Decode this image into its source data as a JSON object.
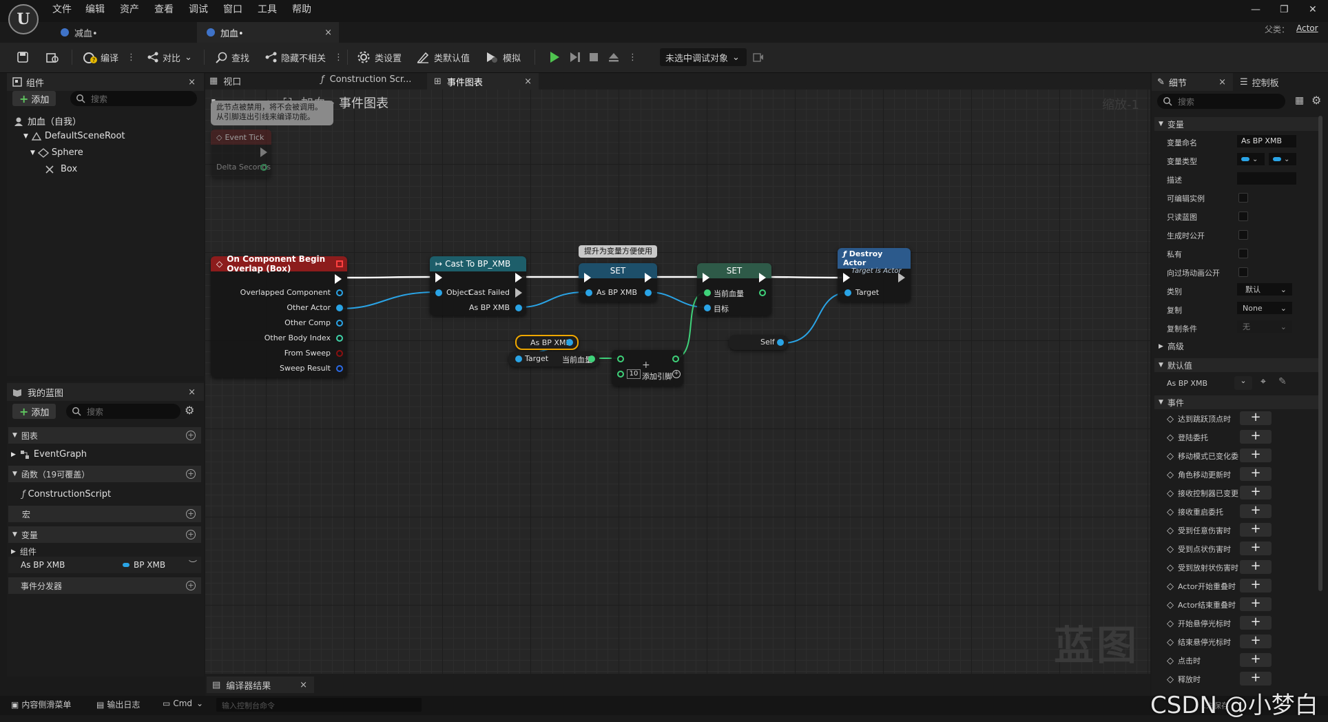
{
  "menu": [
    "文件",
    "编辑",
    "资产",
    "查看",
    "调试",
    "窗口",
    "工具",
    "帮助"
  ],
  "logo_text": "U",
  "window_controls": {
    "minimize": "—",
    "restore": "❐",
    "close": "✕"
  },
  "parent_class": {
    "label": "父类：",
    "value": "Actor"
  },
  "doc_tabs": [
    {
      "label": "减血•"
    },
    {
      "label": "加血•"
    }
  ],
  "tab_close": "×",
  "toolbar": {
    "compile": "编译",
    "diff": "对比",
    "find": "查找",
    "hide_unrelated": "隐藏不相关",
    "class_settings": "类设置",
    "class_defaults": "类默认值",
    "simulate": "模拟",
    "debug_target": "未选中调试对象"
  },
  "components_panel": {
    "title": "组件",
    "add": "添加",
    "search_placeholder": "搜索",
    "tree": [
      {
        "label": "加血（自我）"
      },
      {
        "label": "DefaultSceneRoot"
      },
      {
        "label": "Sphere"
      },
      {
        "label": "Box"
      }
    ]
  },
  "my_blueprint": {
    "title": "我的蓝图",
    "add": "添加",
    "search_placeholder": "搜索",
    "sections": {
      "graphs": "图表",
      "event_graph": "EventGraph",
      "functions": "函数（19可覆盖）",
      "construction_script": "ConstructionScript",
      "macros": "宏",
      "variables": "变量",
      "components": "组件",
      "var_name": "As BP XMB",
      "var_type": "BP XMB",
      "dispatchers": "事件分发器"
    }
  },
  "graph_tabs": [
    {
      "label": "视口"
    },
    {
      "label": "Construction Scr..."
    },
    {
      "label": "事件图表"
    }
  ],
  "breadcrumb": {
    "root": "加血",
    "sep": "›",
    "current": "事件图表"
  },
  "zoom": "缩放-1",
  "watermark": "蓝图",
  "nodes": {
    "disabled_comment": {
      "line1": "此节点被禁用，将不会被调用。",
      "line2": "从引脚连出引线来编译功能。"
    },
    "event_tick": {
      "title": "Event Tick",
      "delta": "Delta Seconds"
    },
    "overlap": {
      "title": "On Component Begin Overlap (Box)",
      "pins": [
        "Overlapped Component",
        "Other Actor",
        "Other Comp",
        "Other Body Index",
        "From Sweep",
        "Sweep Result"
      ]
    },
    "cast": {
      "title": "Cast To BP_XMB",
      "object": "Object",
      "cast_failed": "Cast Failed",
      "as_bp": "As BP XMB"
    },
    "promote_tooltip": "提升为变量方便使用",
    "set1": {
      "title": "SET",
      "pin": "As BP XMB"
    },
    "set2": {
      "title": "SET",
      "pin1": "当前血量",
      "pin2": "目标"
    },
    "destroy": {
      "title": "Destroy Actor",
      "subtitle": "Target is Actor",
      "target": "Target"
    },
    "get_var": {
      "label": "As BP XMB"
    },
    "get_health": {
      "target": "Target",
      "out": "当前血量"
    },
    "add": {
      "value": "10",
      "add_pin": "添加引脚",
      "plus": "+"
    },
    "self": {
      "label": "Self"
    }
  },
  "compiler_results": {
    "title": "编译器结果"
  },
  "details_panel": {
    "tab_details": "细节",
    "tab_palette": "控制板",
    "search_placeholder": "搜索",
    "section_variable": "变量",
    "var_name_label": "变量命名",
    "var_name_value": "As BP XMB",
    "var_type_label": "变量类型",
    "description_label": "描述",
    "instance_editable": "可编辑实例",
    "readonly": "只读蓝图",
    "expose_spawn": "生成时公开",
    "private": "私有",
    "expose_cinematics": "向过场动画公开",
    "category_label": "类别",
    "category_value": "默认",
    "replication_label": "复制",
    "replication_value": "None",
    "rep_condition_label": "复制条件",
    "rep_condition_value": "无",
    "advanced": "高级",
    "default_value_section": "默认值",
    "default_var": "As BP XMB",
    "events_section": "事件",
    "events": [
      "达到跳跃顶点时",
      "登陆委托",
      "移动模式已变化委",
      "角色移动更新时",
      "接收控制器已变更",
      "接收重启委托",
      "受到任意伤害时",
      "受到点状伤害时",
      "受到放射状伤害时",
      "Actor开始重叠时",
      "Actor结束重叠时",
      "开始悬停光标时",
      "结束悬停光标时",
      "点击时",
      "释放时"
    ]
  },
  "statusbar": {
    "content_drawer": "内容侧滑菜单",
    "output_log": "输出日志",
    "cmd": "Cmd",
    "console_placeholder": "输入控制台命令",
    "right_text": "1未保存"
  },
  "csdn_watermark": "CSDN @小梦白",
  "colors": {
    "event_red": "#8c1c1c",
    "cast_teal": "#1d5e6a",
    "set_green": "#2e5a48",
    "destroy_blue": "#2c5a8c",
    "object_pin": "#2aa4e6",
    "float_pin": "#3fd27a",
    "wire_white": "#ffffff"
  }
}
